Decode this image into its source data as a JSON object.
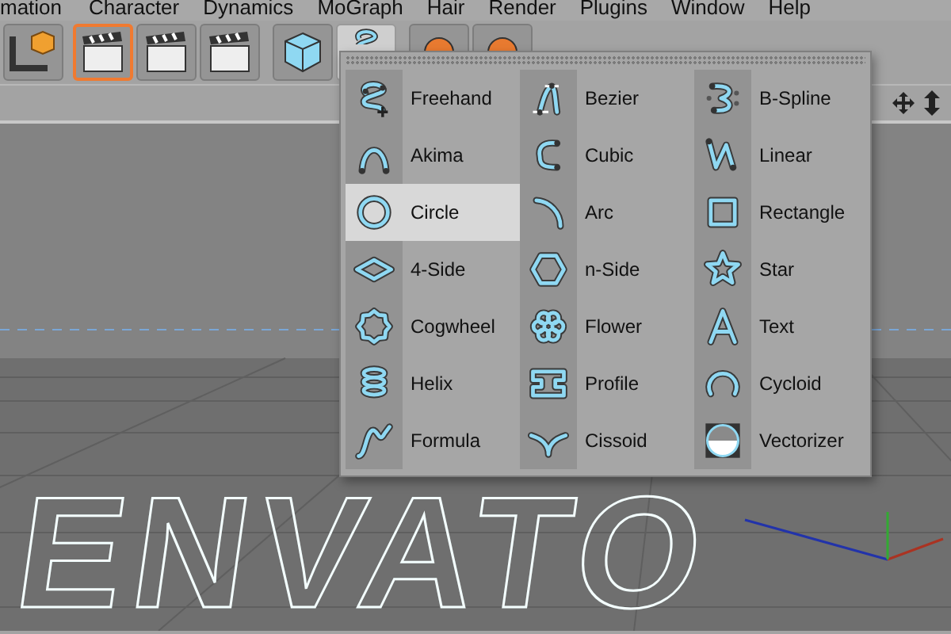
{
  "menu_bar": [
    "mation",
    "Character",
    "Dynamics",
    "MoGraph",
    "Hair",
    "Render",
    "Plugins",
    "Window",
    "Help"
  ],
  "toolbar": {
    "buttons": [
      {
        "selected": false
      },
      {
        "selected": true
      },
      {
        "selected": false
      },
      {
        "selected": false
      },
      {
        "selected": false
      },
      {
        "selected": true
      },
      {
        "selected": false
      },
      {
        "selected": false
      }
    ]
  },
  "viewport": {
    "scene_text": "ENVATO"
  },
  "spline_menu": {
    "items": [
      {
        "label": "Freehand",
        "selected": false
      },
      {
        "label": "Bezier",
        "selected": false
      },
      {
        "label": "B-Spline",
        "selected": false
      },
      {
        "label": "Akima",
        "selected": false
      },
      {
        "label": "Cubic",
        "selected": false
      },
      {
        "label": "Linear",
        "selected": false
      },
      {
        "label": "Circle",
        "selected": true
      },
      {
        "label": "Arc",
        "selected": false
      },
      {
        "label": "Rectangle",
        "selected": false
      },
      {
        "label": "4-Side",
        "selected": false
      },
      {
        "label": "n-Side",
        "selected": false
      },
      {
        "label": "Star",
        "selected": false
      },
      {
        "label": "Cogwheel",
        "selected": false
      },
      {
        "label": "Flower",
        "selected": false
      },
      {
        "label": "Text",
        "selected": false
      },
      {
        "label": "Helix",
        "selected": false
      },
      {
        "label": "Profile",
        "selected": false
      },
      {
        "label": "Cycloid",
        "selected": false
      },
      {
        "label": "Formula",
        "selected": false
      },
      {
        "label": "Cissoid",
        "selected": false
      },
      {
        "label": "Vectorizer",
        "selected": false
      }
    ]
  }
}
